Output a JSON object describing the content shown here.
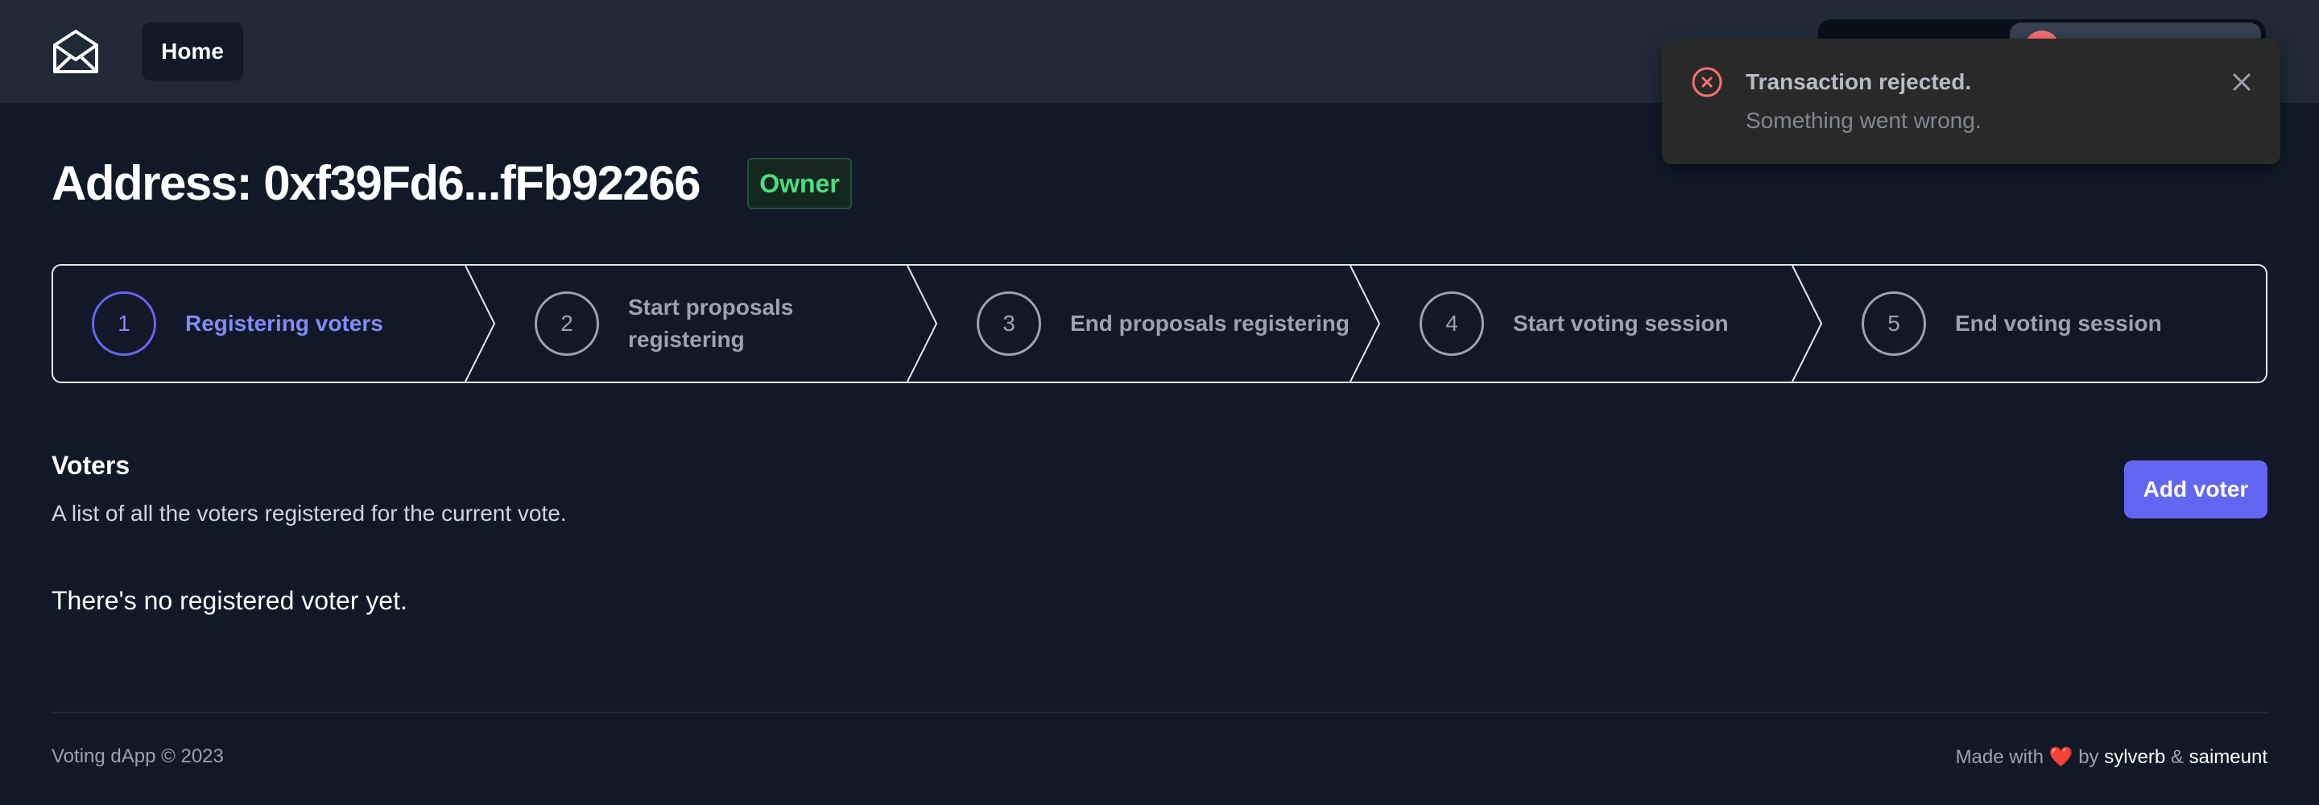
{
  "header": {
    "home_label": "Home"
  },
  "toast": {
    "title": "Transaction rejected.",
    "message": "Something went wrong."
  },
  "page": {
    "title": "Address: 0xf39Fd6...fFb92266",
    "badge": "Owner"
  },
  "stepper": {
    "steps": [
      {
        "number": "1",
        "label": "Registering voters",
        "active": true
      },
      {
        "number": "2",
        "label": "Start proposals registering",
        "active": false
      },
      {
        "number": "3",
        "label": "End proposals registering",
        "active": false
      },
      {
        "number": "4",
        "label": "Start voting session",
        "active": false
      },
      {
        "number": "5",
        "label": "End voting session",
        "active": false
      }
    ]
  },
  "voters": {
    "title": "Voters",
    "description": "A list of all the voters registered for the current vote.",
    "add_button": "Add voter",
    "empty_message": "There's no registered voter yet."
  },
  "footer": {
    "copyright": "Voting dApp © 2023",
    "made_with": "Made with",
    "heart": "❤️",
    "by": "by",
    "author1": "sylverb",
    "amp": "&",
    "author2": "saimeunt"
  },
  "colors": {
    "accent": "#6366f1",
    "background": "#111827",
    "header": "#1f2937",
    "success": "#4ade80",
    "error": "#f87171"
  }
}
